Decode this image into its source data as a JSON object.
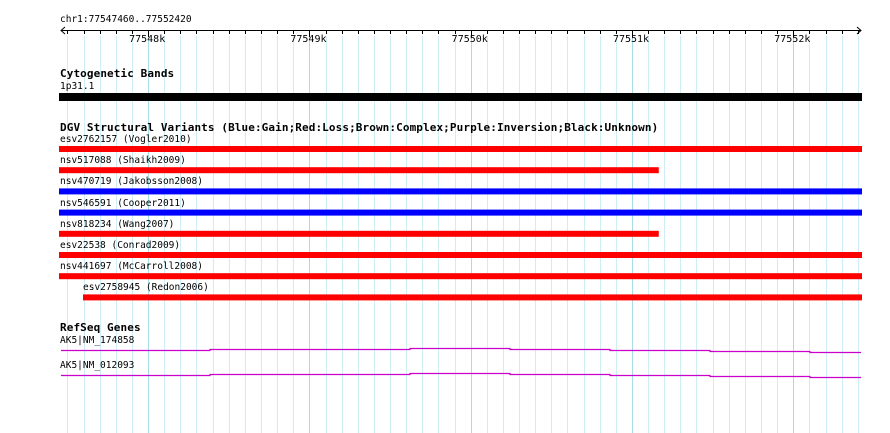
{
  "ruler": {
    "range_label": "chr1:77547460..77552420",
    "start": 77547460,
    "end": 77552420,
    "tick_labels": [
      "77548k",
      "77549k",
      "77550k",
      "77551k",
      "77552k"
    ],
    "tick_positions_bp": [
      77548000,
      77549000,
      77550000,
      77551000,
      77552000
    ]
  },
  "tracks": {
    "cytobands": {
      "title": "Cytogenetic Bands",
      "band_label": "1p31.1",
      "color": "#000000"
    },
    "dgv": {
      "title": "DGV Structural Variants (Blue:Gain;Red:Loss;Brown:Complex;Purple:Inversion;Black:Unknown)",
      "legend_colors": {
        "gain": "#0000ff",
        "loss": "#ff0000",
        "complex": "#a52a2a",
        "inversion": "#800080",
        "unknown": "#000000"
      },
      "variants": [
        {
          "label": "esv2762157 (Vogler2010)",
          "type": "loss",
          "start": 77547460,
          "end": 77552420
        },
        {
          "label": "nsv517088 (Shaikh2009)",
          "type": "loss",
          "start": 77547460,
          "end": 77551160
        },
        {
          "label": "nsv470719 (Jakobsson2008)",
          "type": "gain",
          "start": 77547460,
          "end": 77552420
        },
        {
          "label": "nsv546591 (Cooper2011)",
          "type": "gain",
          "start": 77547460,
          "end": 77552420
        },
        {
          "label": "nsv818234 (Wang2007)",
          "type": "loss",
          "start": 77547460,
          "end": 77551160
        },
        {
          "label": "esv22538 (Conrad2009)",
          "type": "loss",
          "start": 77547460,
          "end": 77552420
        },
        {
          "label": "nsv441697 (McCarroll2008)",
          "type": "loss",
          "start": 77547460,
          "end": 77552420
        },
        {
          "label": "esv2758945 (Redon2006)",
          "type": "loss",
          "start": 77547600,
          "end": 77552420
        }
      ]
    },
    "refseq": {
      "title": "RefSeq Genes",
      "color": "#cc00cc",
      "genes": [
        {
          "label": "AK5|NM_174858"
        },
        {
          "label": "AK5|NM_012093"
        }
      ]
    }
  }
}
